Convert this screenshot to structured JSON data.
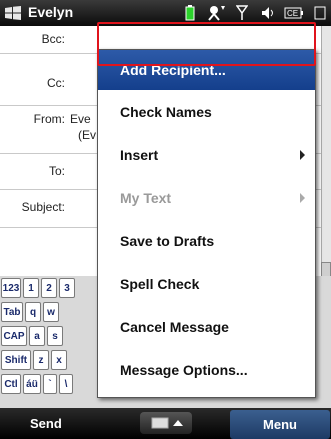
{
  "titlebar": {
    "title": "Evelyn"
  },
  "form": {
    "bcc_label": "Bcc:",
    "cc_label": "Cc:",
    "from_label": "From:",
    "from_value": "Eve",
    "from_value2": "(Ev",
    "to_label": "To:",
    "subject_label": "Subject:"
  },
  "keyboard": {
    "row1": [
      "123",
      "1",
      "2",
      "3"
    ],
    "row2": [
      "Tab",
      "q",
      "w"
    ],
    "row3": [
      "CAP",
      "a",
      "s"
    ],
    "row4": [
      "Shift",
      "z",
      "x"
    ],
    "row5": [
      "Ctl",
      "áü",
      "`",
      "\\"
    ]
  },
  "menu": {
    "items": [
      {
        "label": "Add Recipient...",
        "state": "selected",
        "submenu": false
      },
      {
        "label": "Check Names",
        "state": "normal",
        "submenu": false
      },
      {
        "label": "Insert",
        "state": "normal",
        "submenu": true
      },
      {
        "label": "My Text",
        "state": "disabled",
        "submenu": true
      },
      {
        "label": "Save to Drafts",
        "state": "normal",
        "submenu": false
      },
      {
        "label": "Spell Check",
        "state": "normal",
        "submenu": false
      },
      {
        "label": "Cancel Message",
        "state": "normal",
        "submenu": false
      },
      {
        "label": "Message Options...",
        "state": "normal",
        "submenu": false
      }
    ]
  },
  "softkeys": {
    "left": "Send",
    "right": "Menu"
  },
  "colors": {
    "highlight_border": "#e0141c",
    "selected_bg": "#2d5aa8"
  }
}
